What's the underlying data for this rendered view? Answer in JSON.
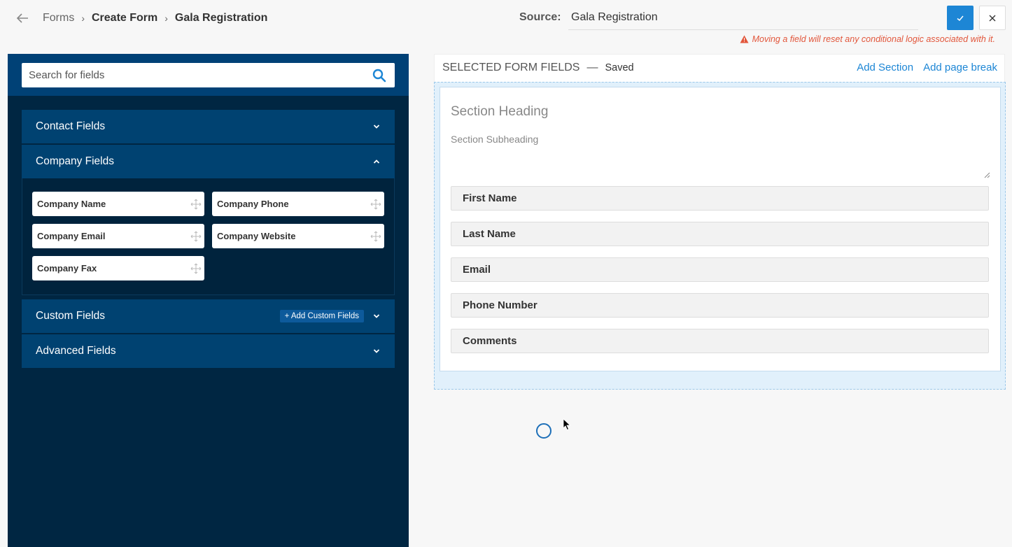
{
  "breadcrumb": {
    "items": [
      "Forms",
      "Create Form",
      "Gala Registration"
    ]
  },
  "source": {
    "label": "Source:",
    "value": "Gala Registration"
  },
  "warning": {
    "text": "Moving a field will reset any conditional logic associated with it."
  },
  "search": {
    "placeholder": "Search for fields"
  },
  "accordions": {
    "contact": {
      "title": "Contact Fields"
    },
    "company": {
      "title": "Company Fields",
      "fields": [
        "Company Name",
        "Company Phone",
        "Company Email",
        "Company Website",
        "Company Fax"
      ]
    },
    "custom": {
      "title": "Custom Fields",
      "add_label": "+ Add Custom Fields"
    },
    "advanced": {
      "title": "Advanced Fields"
    }
  },
  "selected": {
    "title": "SELECTED FORM FIELDS",
    "dash": "—",
    "status": "Saved",
    "add_section": "Add Section",
    "add_page_break": "Add page break",
    "section_heading": "Section Heading",
    "section_subheading": "Section Subheading",
    "fields": [
      "First Name",
      "Last Name",
      "Email",
      "Phone Number",
      "Comments"
    ]
  },
  "colors": {
    "accent": "#1d86d5",
    "panel": "#002642",
    "header": "#004271",
    "warning": "#e2563b"
  }
}
